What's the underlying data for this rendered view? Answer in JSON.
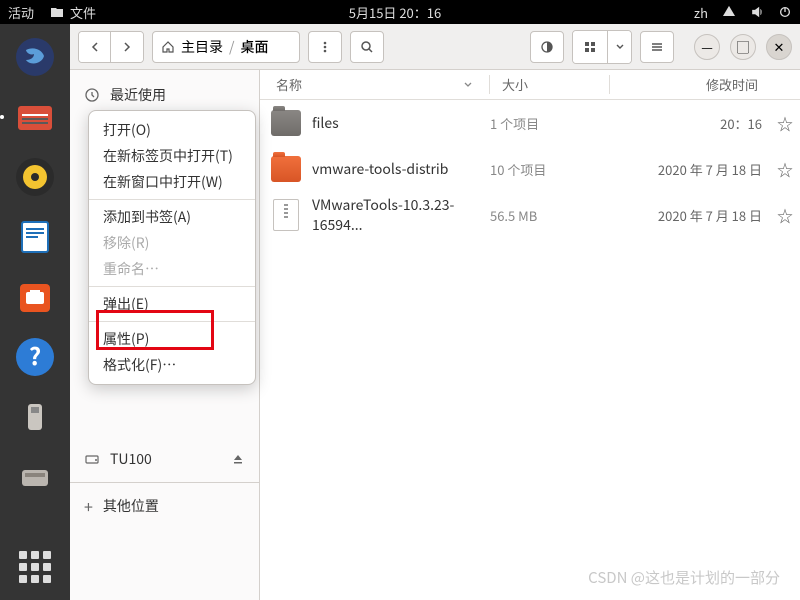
{
  "topbar": {
    "activities": "活动",
    "app_name": "文件",
    "datetime": "5月15日  20：16",
    "lang": "zh"
  },
  "toolbar": {
    "breadcrumb_home": "主目录",
    "breadcrumb_current": "桌面"
  },
  "sidebar": {
    "recent": "最近使用",
    "device": "TU100",
    "other": "其他位置"
  },
  "columns": {
    "name": "名称",
    "size": "大小",
    "date": "修改时间"
  },
  "files": [
    {
      "name": "files",
      "size": "1 个项目",
      "date": "20：16",
      "type": "folder-gray"
    },
    {
      "name": "vmware-tools-distrib",
      "size": "10 个项目",
      "date": "2020 年 7 月 18 日",
      "type": "folder-orange"
    },
    {
      "name": "VMwareTools-10.3.23-16594...",
      "size": "56.5 MB",
      "date": "2020 年 7 月 18 日",
      "type": "archive"
    }
  ],
  "menu": {
    "open": "打开(O)",
    "open_tab": "在新标签页中打开(T)",
    "open_window": "在新窗口中打开(W)",
    "bookmark": "添加到书签(A)",
    "remove": "移除(R)",
    "rename": "重命名…",
    "eject": "弹出(E)",
    "properties": "属性(P)",
    "format": "格式化(F)…"
  },
  "watermark": "CSDN @这也是计划的一部分"
}
